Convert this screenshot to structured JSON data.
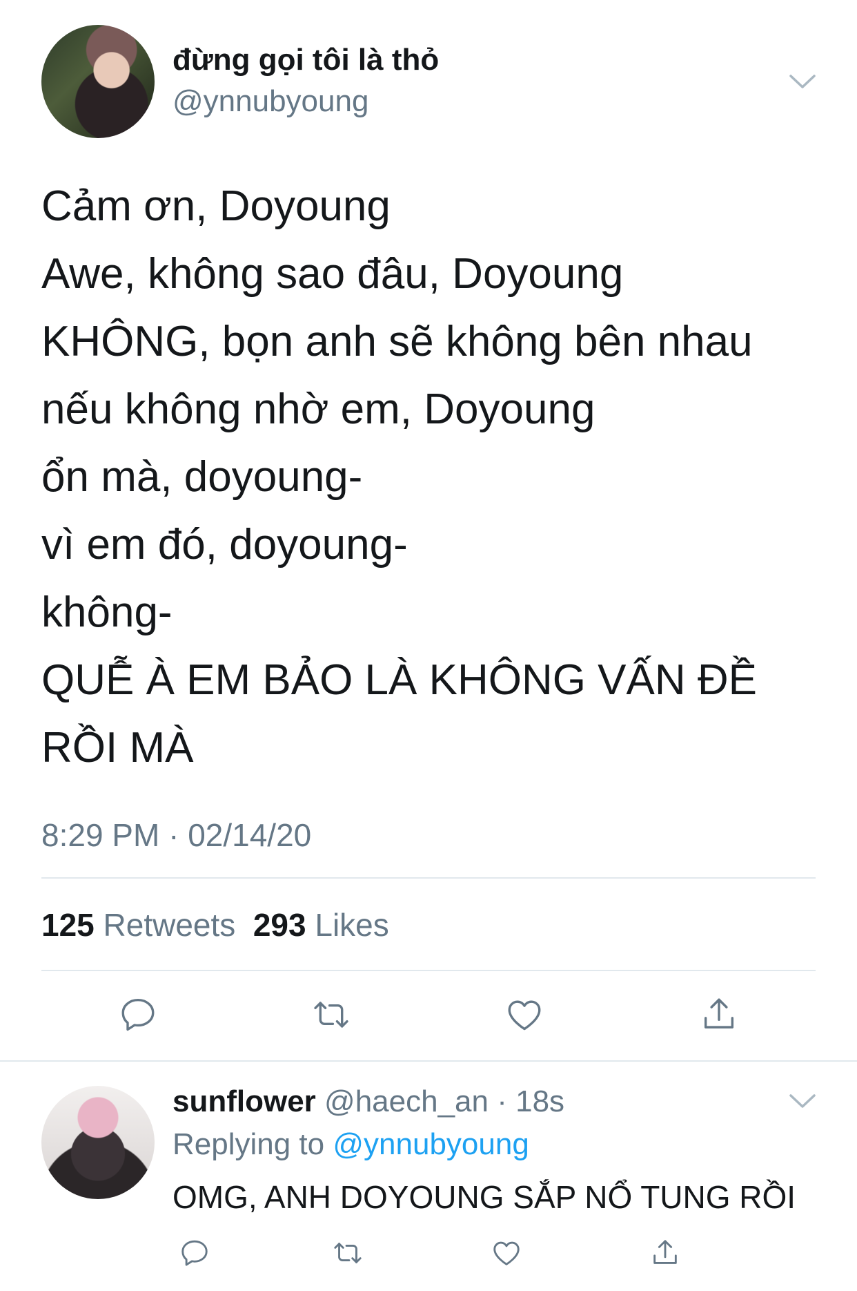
{
  "tweet": {
    "display_name": "đừng gọi tôi là thỏ",
    "handle": "@ynnubyoung",
    "lines": [
      "Cảm ơn, Doyoung",
      "Awe, không sao đâu, Doyoung",
      "KHÔNG, bọn anh sẽ không bên nhau",
      "nếu không nhờ em, Doyoung",
      "ổn mà, doyoung-",
      "vì em đó, doyoung-",
      "không-",
      "QUỄ À EM BẢO LÀ KHÔNG VẤN ĐỀ",
      "RỒI MÀ"
    ],
    "timestamp": "8:29 PM · 02/14/20",
    "retweets_count": "125",
    "retweets_label": "Retweets",
    "likes_count": "293",
    "likes_label": "Likes"
  },
  "reply": {
    "display_name": "sunflower",
    "meta": "@haech_an · 18s",
    "replying_prefix": "Replying to",
    "replying_handle": "@ynnubyoung",
    "text": "OMG, ANH DOYOUNG SẮP NỔ TUNG RỒI"
  },
  "icons": [
    "chevron-down-icon",
    "reply-icon",
    "retweet-icon",
    "like-icon",
    "share-icon"
  ],
  "colors": {
    "text": "#14171a",
    "secondary": "#657786",
    "link": "#1da1f2",
    "divider": "#e1e8ed"
  }
}
